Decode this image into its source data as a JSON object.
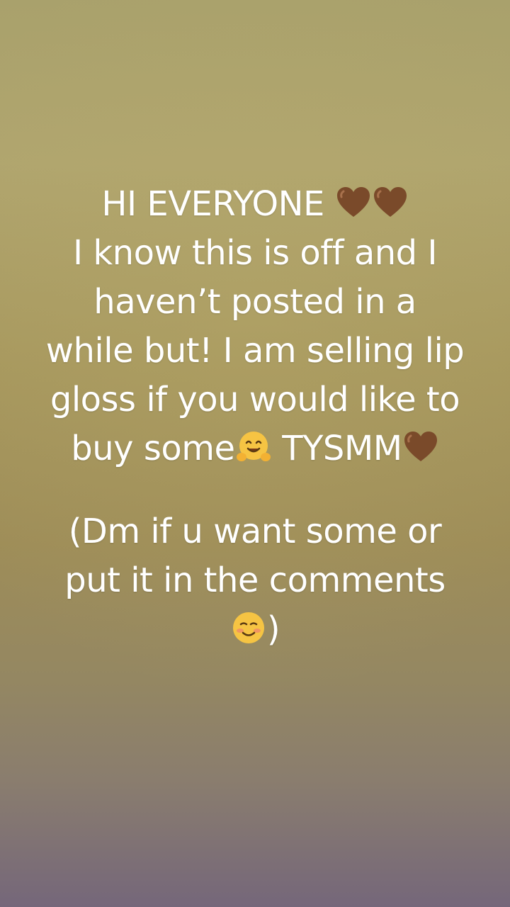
{
  "caption": {
    "line1_text": "HI EVERYONE ",
    "line1_icons": [
      "brown-heart-icon",
      "brown-heart-icon"
    ],
    "line2": "I know this is off and I",
    "line3": "haven’t posted in a",
    "line4": "while but! I am selling lip",
    "line5": "gloss if you would like to",
    "line6_a": "buy some",
    "line6_icon_1": "hugging-face-icon",
    "line6_b": " TYSMM",
    "line6_icon_2": "brown-heart-icon",
    "line7": "(Dm if u want some or",
    "line8": "put it in the comments",
    "line9_icon": "smiling-face-icon",
    "line9_text": ")"
  },
  "colors": {
    "text": "#ffffff",
    "background_top": "#a9a16c",
    "background_bottom": "#75677a",
    "heart": "#7a4a2a"
  }
}
